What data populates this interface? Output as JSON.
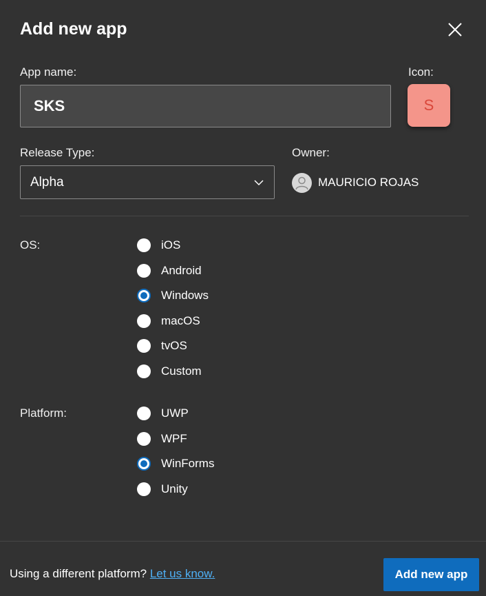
{
  "dialog": {
    "title": "Add new app",
    "close_icon": "close-icon"
  },
  "app_name": {
    "label": "App name:",
    "value": "SKS"
  },
  "icon": {
    "label": "Icon:",
    "letter": "S",
    "tile_color": "#f4958a",
    "letter_color": "#d9473a"
  },
  "release_type": {
    "label": "Release Type:",
    "selected": "Alpha",
    "icon": "chevron-down-icon"
  },
  "owner": {
    "label": "Owner:",
    "name": "MAURICIO ROJAS",
    "avatar_icon": "person-icon"
  },
  "os": {
    "label": "OS:",
    "options": [
      {
        "label": "iOS",
        "checked": false
      },
      {
        "label": "Android",
        "checked": false
      },
      {
        "label": "Windows",
        "checked": true
      },
      {
        "label": "macOS",
        "checked": false
      },
      {
        "label": "tvOS",
        "checked": false
      },
      {
        "label": "Custom",
        "checked": false
      }
    ]
  },
  "platform": {
    "label": "Platform:",
    "options": [
      {
        "label": "UWP",
        "checked": false
      },
      {
        "label": "WPF",
        "checked": false
      },
      {
        "label": "WinForms",
        "checked": true
      },
      {
        "label": "Unity",
        "checked": false
      }
    ]
  },
  "footer": {
    "prompt": "Using a different platform?",
    "link": "Let us know.",
    "submit_label": "Add new app"
  },
  "colors": {
    "background": "#323232",
    "accent": "#0f6cbd",
    "link": "#4fb0f5"
  }
}
